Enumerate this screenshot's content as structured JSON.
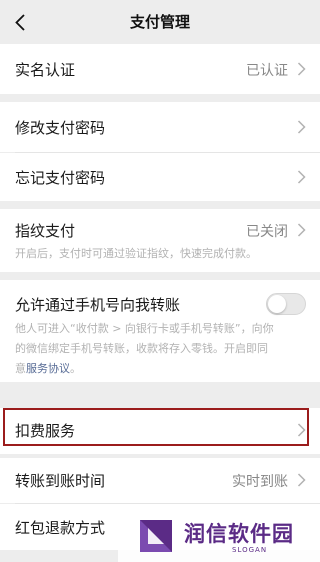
{
  "nav": {
    "title": "支付管理"
  },
  "sections": {
    "realname": {
      "title": "实名认证",
      "value": "已认证"
    },
    "change_pwd": {
      "title": "修改支付密码"
    },
    "forgot_pwd": {
      "title": "忘记支付密码"
    },
    "fingerprint": {
      "title": "指纹支付",
      "value": "已关闭",
      "desc": "开启后，支付时可通过验证指纹，快速完成付款。"
    },
    "phone_transfer": {
      "title": "允许通过手机号向我转账",
      "toggle_on": false,
      "desc_line1": "他人可进入“收付款 > 向银行卡或手机号转账”，向你",
      "desc_line2": "的微信绑定手机号转账，收款将存入零钱。开启即同",
      "desc_prefix": "意",
      "desc_link": "服务协议",
      "desc_suffix": "。"
    },
    "deduction": {
      "title": "扣费服务"
    },
    "arrival_time": {
      "title": "转账到账时间",
      "value": "实时到账"
    },
    "redpacket_refund": {
      "title": "红包退款方式"
    }
  },
  "watermark": {
    "name": "润信软件园",
    "slogan": "SLOGAN"
  },
  "colors": {
    "background": "#ededed",
    "link": "#576b95",
    "highlight": "#9b1c1c",
    "brand": "#5b2b86"
  }
}
